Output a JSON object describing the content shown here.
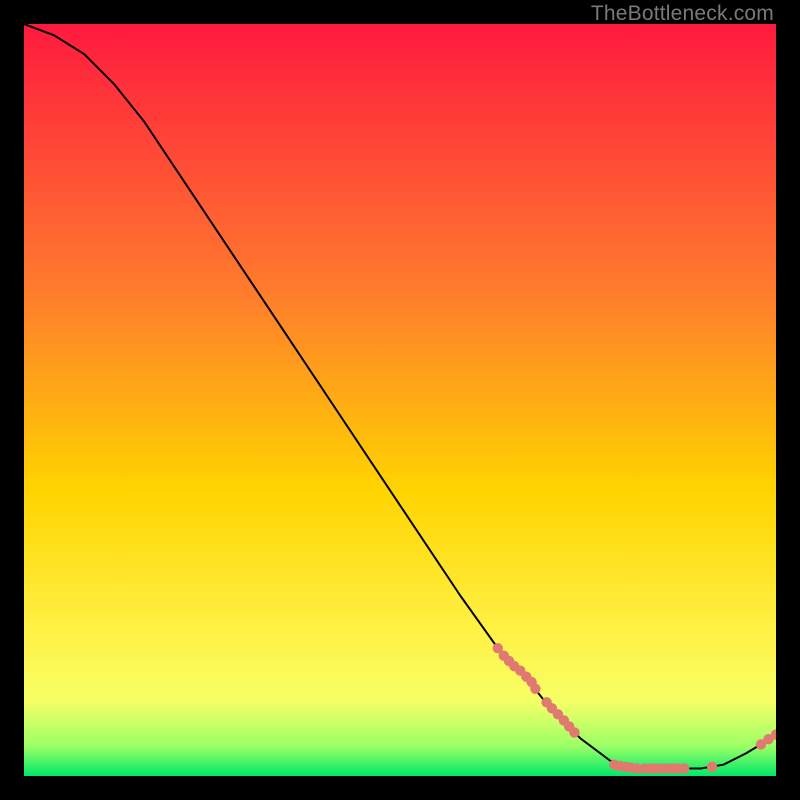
{
  "watermark": "TheBottleneck.com",
  "colors": {
    "gradient_top": "#ff1a3e",
    "gradient_mid1": "#ff6a2e",
    "gradient_mid2": "#ffd400",
    "gradient_mid3": "#fff34a",
    "gradient_bottom": "#00e86a",
    "curve": "#000000",
    "marker": "#e0796f",
    "background": "#000000"
  },
  "chart_data": {
    "type": "line",
    "title": "",
    "xlabel": "",
    "ylabel": "",
    "xlim": [
      0,
      100
    ],
    "ylim": [
      0,
      100
    ],
    "grid": false,
    "legend": false,
    "curve": [
      {
        "x": 0,
        "y": 100
      },
      {
        "x": 4,
        "y": 98.5
      },
      {
        "x": 8,
        "y": 96
      },
      {
        "x": 12,
        "y": 92
      },
      {
        "x": 16,
        "y": 87
      },
      {
        "x": 20,
        "y": 81
      },
      {
        "x": 26,
        "y": 72
      },
      {
        "x": 34,
        "y": 60
      },
      {
        "x": 42,
        "y": 48
      },
      {
        "x": 50,
        "y": 36
      },
      {
        "x": 58,
        "y": 24
      },
      {
        "x": 63,
        "y": 17
      },
      {
        "x": 66,
        "y": 14
      },
      {
        "x": 70,
        "y": 9
      },
      {
        "x": 74,
        "y": 5
      },
      {
        "x": 78,
        "y": 2
      },
      {
        "x": 82,
        "y": 1
      },
      {
        "x": 86,
        "y": 1
      },
      {
        "x": 90,
        "y": 1
      },
      {
        "x": 93,
        "y": 1.5
      },
      {
        "x": 96,
        "y": 3
      },
      {
        "x": 98,
        "y": 4.2
      },
      {
        "x": 100,
        "y": 5.5
      }
    ],
    "markers": [
      {
        "x": 63.0,
        "y": 17.0
      },
      {
        "x": 63.8,
        "y": 16.0
      },
      {
        "x": 64.5,
        "y": 15.3
      },
      {
        "x": 65.2,
        "y": 14.6
      },
      {
        "x": 66.0,
        "y": 14.0
      },
      {
        "x": 66.8,
        "y": 13.2
      },
      {
        "x": 67.5,
        "y": 12.5
      },
      {
        "x": 68.0,
        "y": 11.6
      },
      {
        "x": 69.5,
        "y": 9.8
      },
      {
        "x": 70.2,
        "y": 9.0
      },
      {
        "x": 71.0,
        "y": 8.2
      },
      {
        "x": 71.8,
        "y": 7.4
      },
      {
        "x": 72.5,
        "y": 6.6
      },
      {
        "x": 73.2,
        "y": 5.8
      },
      {
        "x": 78.5,
        "y": 1.5
      },
      {
        "x": 79.3,
        "y": 1.3
      },
      {
        "x": 80.0,
        "y": 1.2
      },
      {
        "x": 80.7,
        "y": 1.1
      },
      {
        "x": 81.5,
        "y": 1.0
      },
      {
        "x": 82.5,
        "y": 1.0
      },
      {
        "x": 83.3,
        "y": 1.0
      },
      {
        "x": 84.0,
        "y": 1.0
      },
      {
        "x": 84.8,
        "y": 1.0
      },
      {
        "x": 85.5,
        "y": 1.0
      },
      {
        "x": 86.3,
        "y": 1.0
      },
      {
        "x": 87.0,
        "y": 1.0
      },
      {
        "x": 87.8,
        "y": 1.0
      },
      {
        "x": 91.5,
        "y": 1.2
      },
      {
        "x": 98.0,
        "y": 4.2
      },
      {
        "x": 99.0,
        "y": 4.9
      },
      {
        "x": 100.0,
        "y": 5.5
      }
    ]
  }
}
